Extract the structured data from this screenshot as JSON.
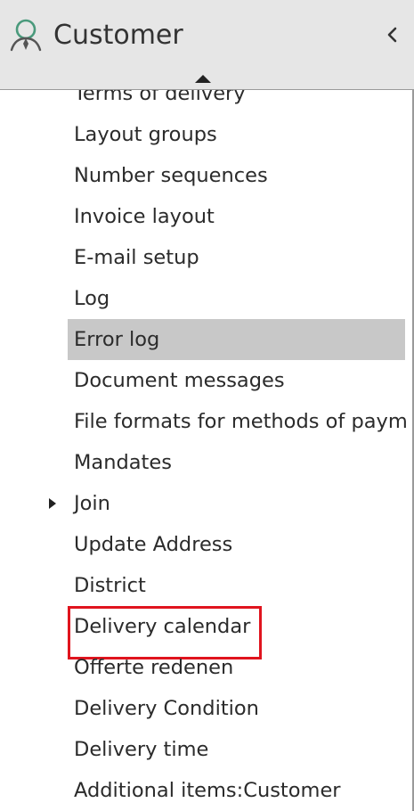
{
  "header": {
    "title": "Customer",
    "icon": "person-icon",
    "collapse_icon": "chevron-left-icon",
    "scroll_icon": "scroll-up-arrow-icon"
  },
  "colors": {
    "header_bg": "#e6e6e6",
    "selected_bg": "#c8c8c8",
    "highlight_border": "#e0141e",
    "icon_green": "#4a9a7c"
  },
  "menu": {
    "items": [
      {
        "label": "Terms of delivery"
      },
      {
        "label": "Layout groups"
      },
      {
        "label": "Number sequences"
      },
      {
        "label": "Invoice layout"
      },
      {
        "label": "E-mail setup"
      },
      {
        "label": "Log"
      },
      {
        "label": "Error log",
        "selected": true
      },
      {
        "label": "Document messages"
      },
      {
        "label": "File formats for methods of paym"
      },
      {
        "label": "Mandates"
      },
      {
        "label": "Join",
        "expandable": true
      },
      {
        "label": "Update Address"
      },
      {
        "label": "District"
      },
      {
        "label": "Delivery calendar",
        "highlighted": true
      },
      {
        "label": "Offerte redenen"
      },
      {
        "label": "Delivery Condition"
      },
      {
        "label": "Delivery time"
      },
      {
        "label": "Additional items:Customer"
      }
    ]
  }
}
